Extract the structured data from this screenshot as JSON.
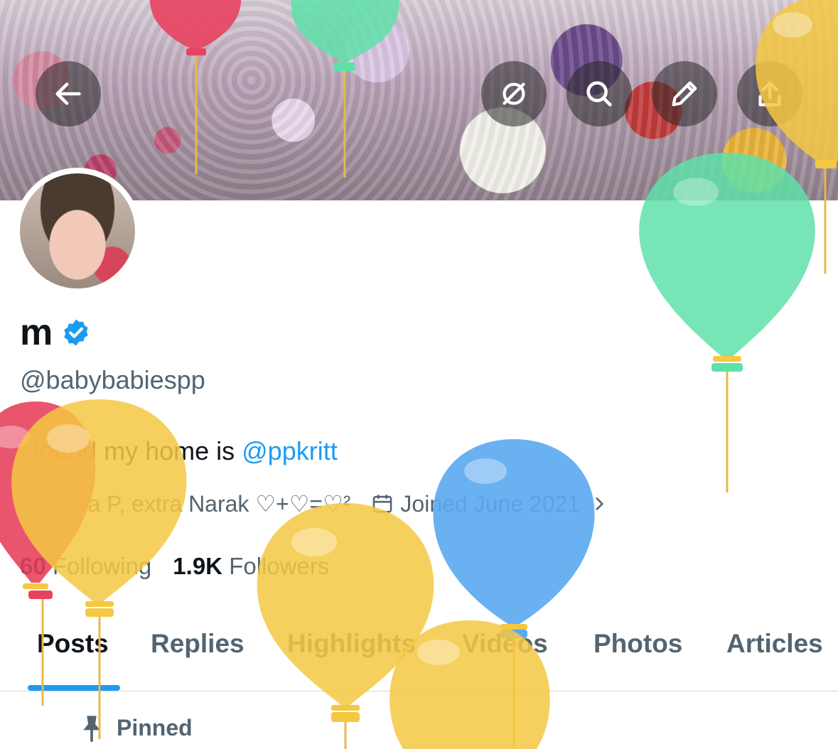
{
  "profile": {
    "name": "m",
    "handle": "@babybabiespp",
    "bio_text": "i found my home is ",
    "bio_mention": "@ppkritt",
    "location": "extra P, extra Narak ♡+♡=♡²",
    "joined": "Joined June 2021",
    "following_count": "60",
    "following_label": "Following",
    "followers_count": "1.9K",
    "followers_label": "Followers"
  },
  "tabs": [
    "Posts",
    "Replies",
    "Highlights",
    "Videos",
    "Photos",
    "Articles"
  ],
  "active_tab": "Posts",
  "pinned_label": "Pinned",
  "icons": [
    "back-arrow-icon",
    "grok-icon",
    "search-icon",
    "pencil-icon",
    "share-icon",
    "verified-badge-icon",
    "location-icon",
    "calendar-icon",
    "chevron-right-icon",
    "pin-icon"
  ],
  "colors": {
    "accent": "#1d9bf0",
    "text": "#0f1419",
    "secondary": "#536471",
    "balloon_red": "#e8435e",
    "balloon_yellow": "#f5c842",
    "balloon_green": "#5fe0a8",
    "balloon_blue": "#5aa8f0"
  }
}
